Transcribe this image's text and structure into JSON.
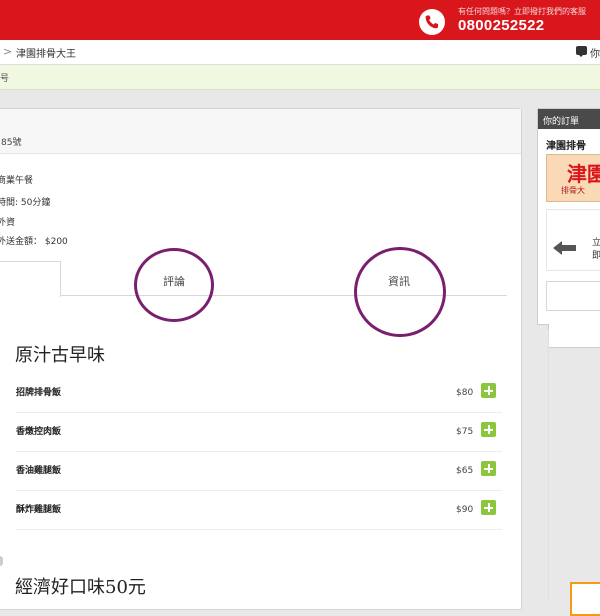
{
  "header": {
    "call_note": "有任何問題嗎？立即撥打我們的客服",
    "phone_number": "0800252522"
  },
  "breadcrumb": {
    "separator": ">",
    "current": "津園排骨大王",
    "chat_label": "你"
  },
  "notice": {
    "text": "号"
  },
  "restaurant": {
    "shop_no": "85號",
    "info_lines": [
      "商業午餐",
      "時間: 50分鐘",
      "外資",
      "外送金額： $200"
    ]
  },
  "tabs": [
    {
      "label": "評論"
    },
    {
      "label": "資訊"
    }
  ],
  "menu": {
    "categories": [
      {
        "title": "原汁古早味",
        "items": [
          {
            "name": "招牌排骨飯",
            "price": "$80"
          },
          {
            "name": "香燉控肉飯",
            "price": "$75"
          },
          {
            "name": "香油雞腿飯",
            "price": "$65"
          },
          {
            "name": "酥炸雞腿飯",
            "price": "$90"
          }
        ]
      },
      {
        "title": "經濟好口味50元",
        "items": []
      }
    ]
  },
  "order_panel": {
    "title": "你的訂單",
    "shop_name": "津園排骨",
    "logo_main": "津園",
    "logo_sub": "排骨大",
    "now_label": "立即"
  },
  "colors": {
    "brand_red": "#d9161c",
    "add_green": "#8cc63f",
    "annotation_purple": "#7a1f6e"
  }
}
